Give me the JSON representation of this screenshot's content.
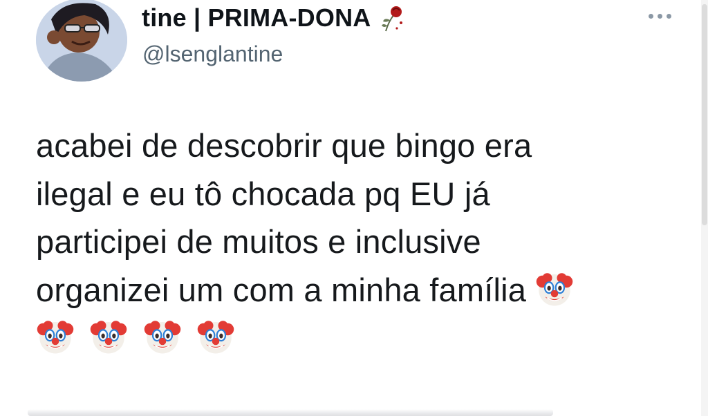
{
  "tweet": {
    "author": {
      "display_name": "tine | PRIMA-DONA",
      "name_icon": "rose-icon",
      "handle": "@lsenglantine",
      "avatar": "cartoon-avatar-with-sunglasses"
    },
    "more_icon": "more-options-icon",
    "text_lines": [
      "acabei de descobrir que bingo era",
      "ilegal e eu tô chocada pq EU já",
      "participei de muitos e inclusive",
      "organizei um com a minha família"
    ],
    "emojis": {
      "inline_after_last_line": "clown-face-emoji",
      "trailing_row": [
        "clown-face-emoji",
        "clown-face-emoji",
        "clown-face-emoji",
        "clown-face-emoji"
      ]
    }
  }
}
